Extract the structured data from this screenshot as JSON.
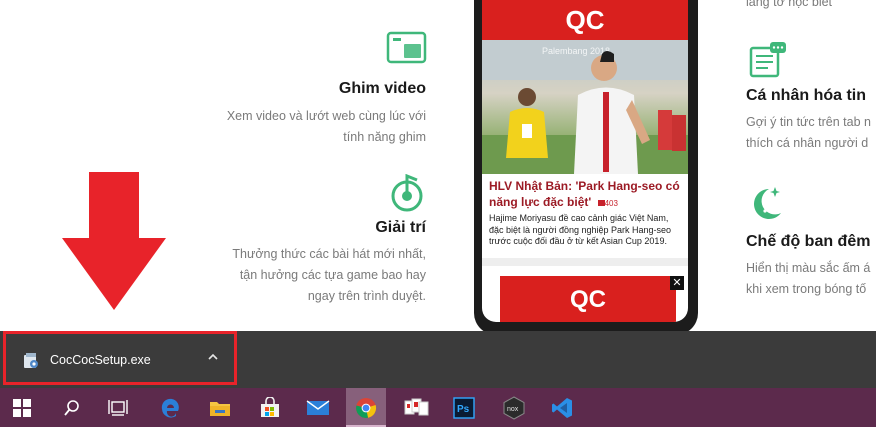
{
  "features_left": [
    {
      "title": "Ghim video",
      "lines": [
        "Xem video và lướt web cùng lúc với",
        "tính năng ghim"
      ],
      "icon": "pin-video-icon"
    },
    {
      "title": "Giải trí",
      "lines": [
        "Thưởng thức các bài hát mới nhất,",
        "tận hưởng các tựa game bao hay",
        "ngay trên trình duyệt."
      ],
      "icon": "entertainment-icon"
    }
  ],
  "features_right": [
    {
      "title": "",
      "lines": [
        "lắng tờ học biết"
      ],
      "icon": ""
    },
    {
      "title": "Cá nhân hóa tin",
      "lines": [
        "Gợi ý tin tức trên tab n",
        "thích cá nhân người d"
      ],
      "icon": "personalize-news-icon"
    },
    {
      "title": "Chế độ ban đêm",
      "lines": [
        "Hiển thị màu sắc ấm á",
        "khi xem trong bóng tố"
      ],
      "icon": "night-mode-icon"
    }
  ],
  "phone": {
    "ad_top": "QC",
    "article_title": "HLV Nhật Bản: 'Park Hang-seo có năng lực đặc biệt'",
    "comment_count": "403",
    "article_desc": "Hajime Moriyasu đề cao cảnh giác Việt Nam, đặc biệt là người đồng nghiệp Park Hang-seo trước cuộc đối đầu ở từ kết Asian Cup 2019.",
    "photo_caption": "Palembang 2018",
    "ad_bottom": "QC",
    "ad_close": "✕"
  },
  "download_bar": {
    "filename": "CocCocSetup.exe",
    "caret": "^"
  },
  "taskbar": {
    "items": [
      "windows-start",
      "search",
      "task-view",
      "edge",
      "file-explorer",
      "microsoft-store",
      "mail",
      "chrome",
      "app-cards",
      "photoshop",
      "nox",
      "vscode"
    ],
    "active": "chrome"
  },
  "colors": {
    "accent_red": "#e8232a",
    "green": "#3fb77a",
    "taskbar": "#5c2a4c"
  }
}
